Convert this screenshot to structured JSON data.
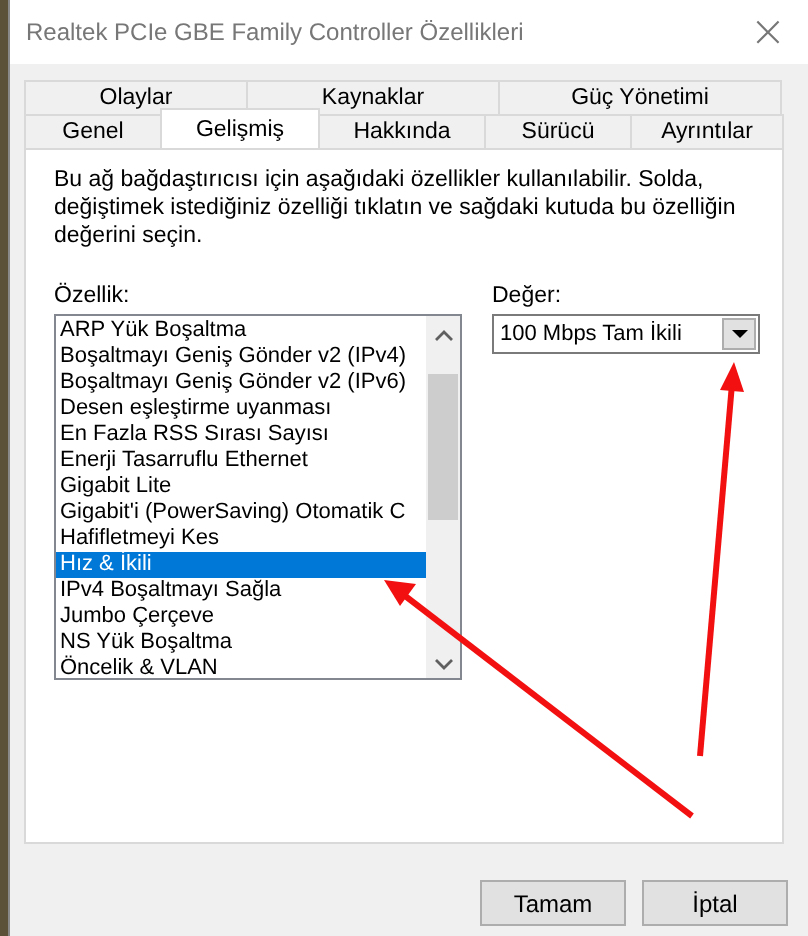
{
  "window": {
    "title": "Realtek PCIe GBE Family Controller Özellikleri",
    "close": "×"
  },
  "tab_rows": [
    [
      {
        "label": "Olaylar",
        "selected": false
      },
      {
        "label": "Kaynaklar",
        "selected": false
      },
      {
        "label": "Güç Yönetimi",
        "selected": false
      }
    ],
    [
      {
        "label": "Genel",
        "selected": false
      },
      {
        "label": "Gelişmiş",
        "selected": true
      },
      {
        "label": "Hakkında",
        "selected": false
      },
      {
        "label": "Sürücü",
        "selected": false
      },
      {
        "label": "Ayrıntılar",
        "selected": false
      }
    ]
  ],
  "description": "Bu ağ bağdaştırıcısı için aşağıdaki özellikler kullanılabilir. Solda, değiştimek istediğiniz özelliği tıklatın ve sağdaki kutuda bu özelliğin değerini seçin.",
  "property": {
    "label": "Özellik:",
    "items": [
      {
        "label": "ARP Yük Boşaltma",
        "selected": false
      },
      {
        "label": "Boşaltmayı Geniş Gönder v2 (IPv4)",
        "selected": false
      },
      {
        "label": "Boşaltmayı Geniş Gönder v2 (IPv6)",
        "selected": false
      },
      {
        "label": "Desen eşleştirme uyanması",
        "selected": false
      },
      {
        "label": "En Fazla RSS Sırası Sayısı",
        "selected": false
      },
      {
        "label": "Enerji Tasarruflu Ethernet",
        "selected": false
      },
      {
        "label": "Gigabit Lite",
        "selected": false
      },
      {
        "label": "Gigabit'i (PowerSaving) Otomatik C",
        "selected": false
      },
      {
        "label": "Hafifletmeyi Kes",
        "selected": false
      },
      {
        "label": "Hız & İkili",
        "selected": true
      },
      {
        "label": "IPv4 Boşaltmayı Sağla",
        "selected": false
      },
      {
        "label": "Jumbo Çerçeve",
        "selected": false
      },
      {
        "label": "NS Yük Boşaltma",
        "selected": false
      },
      {
        "label": "Öncelik & VLAN",
        "selected": false
      }
    ]
  },
  "value": {
    "label": "Değer:",
    "selected_value": "100 Mbps Tam İkili"
  },
  "buttons": [
    "Tamam",
    "İptal"
  ]
}
